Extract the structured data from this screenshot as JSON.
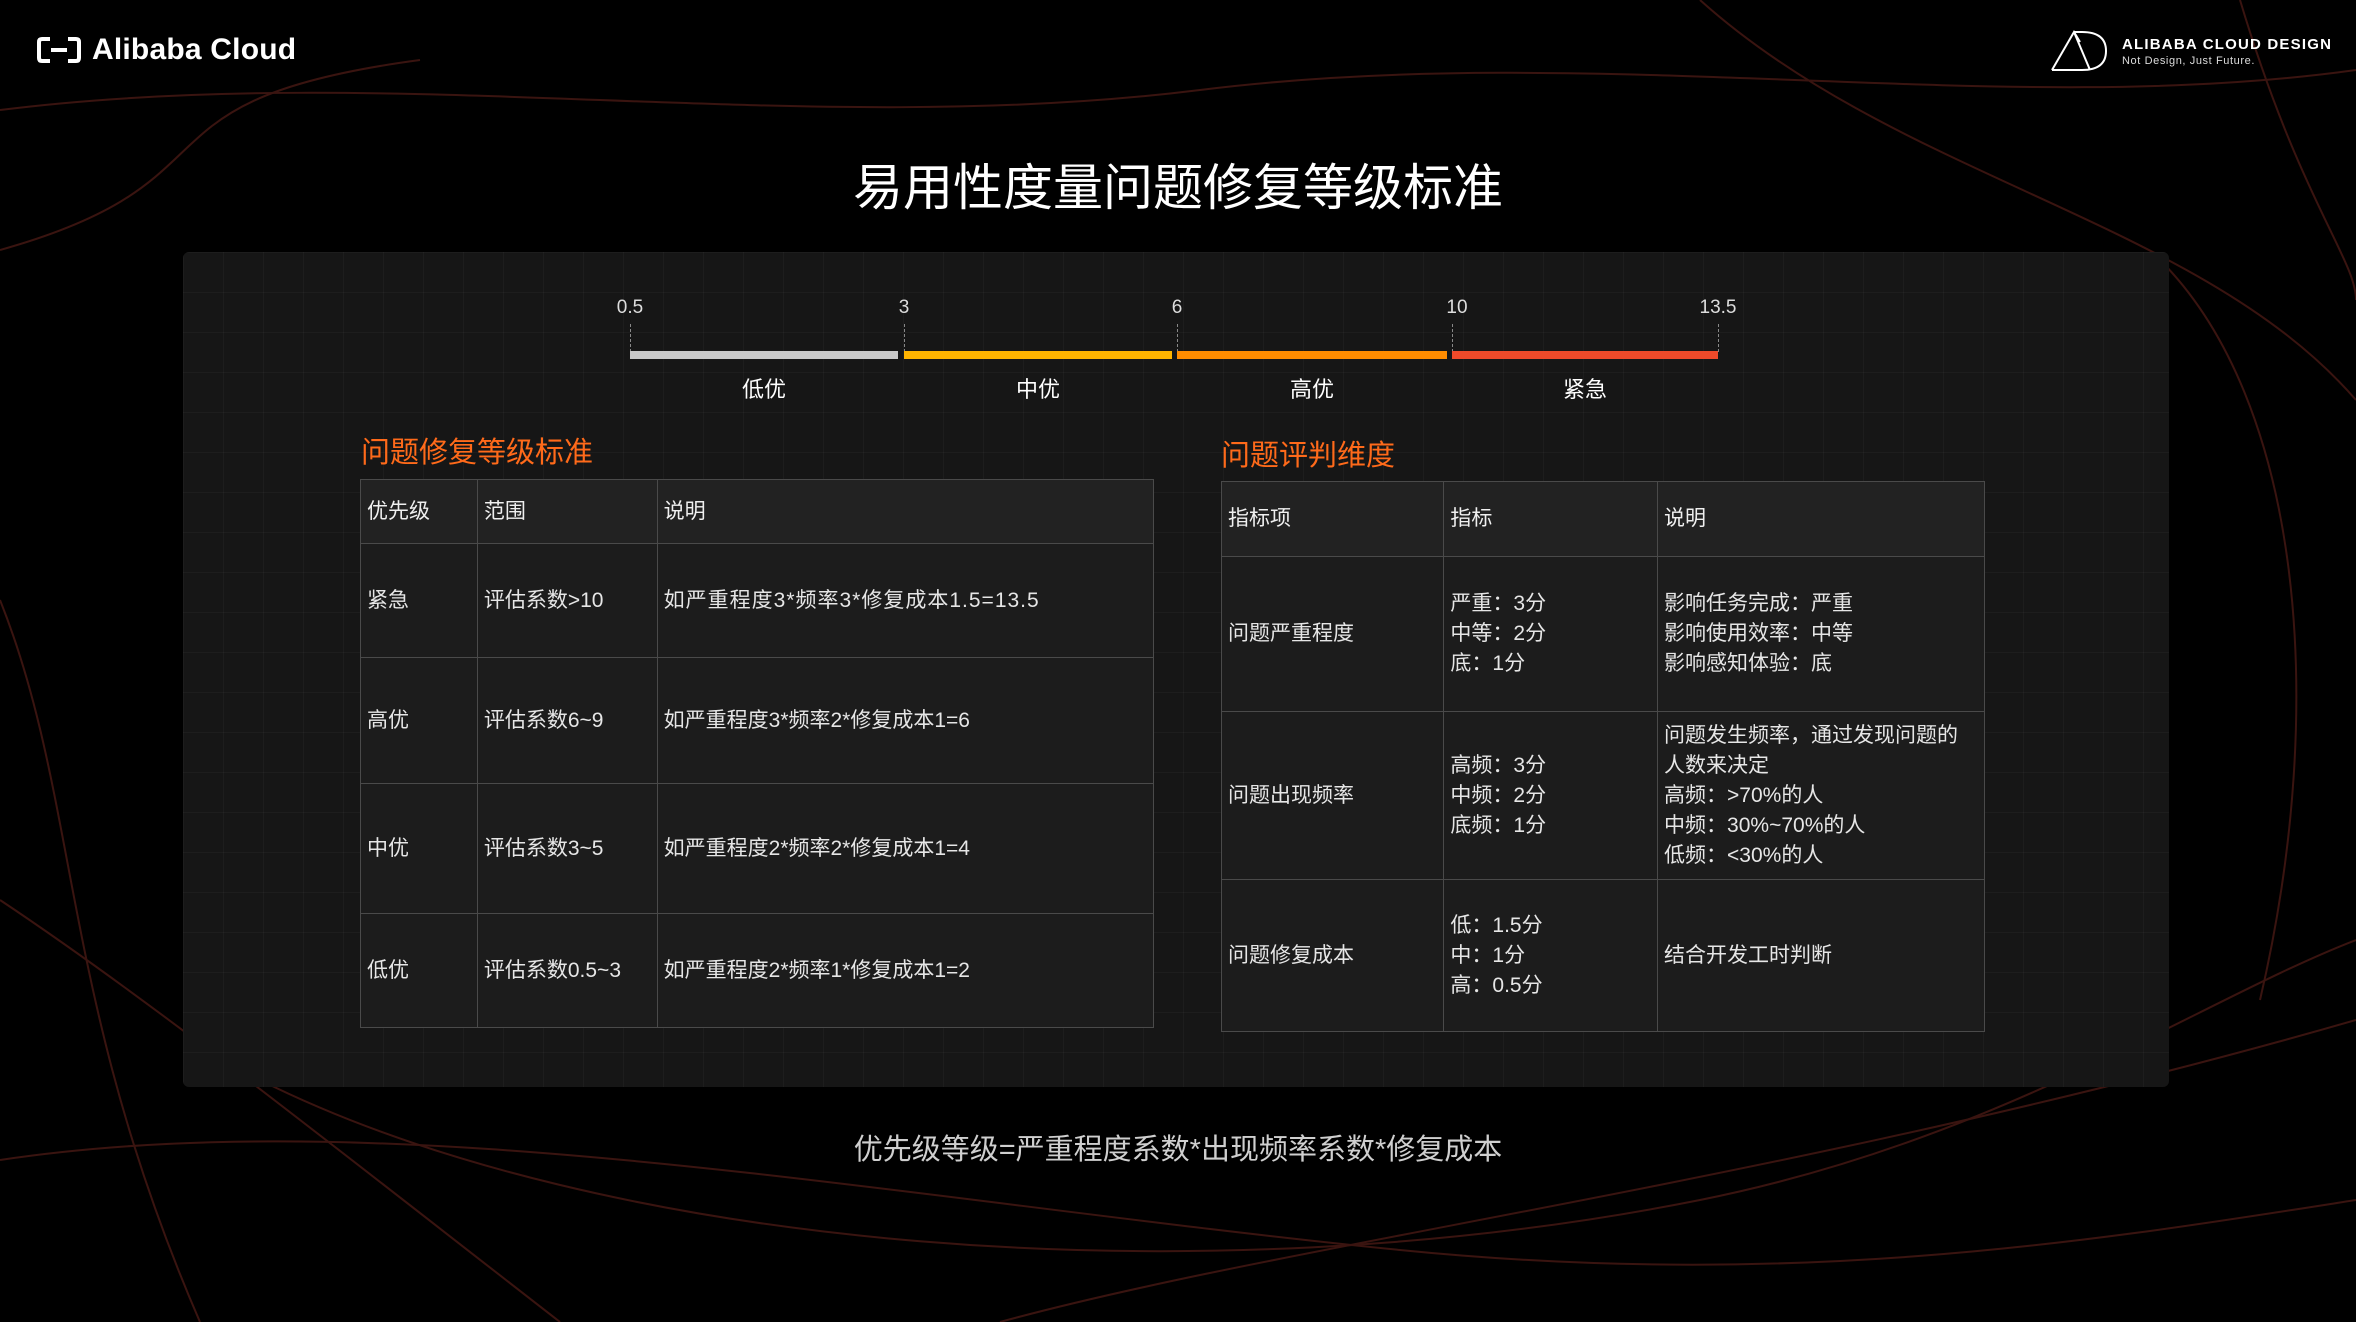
{
  "header": {
    "brand_left": "Alibaba Cloud",
    "brand_right": "ALIBABA CLOUD DESIGN",
    "brand_right_tagline": "Not Design, Just Future.",
    "logo_left_icon": "alibaba-cloud-bracket-icon",
    "logo_right_icon": "triangle-d-mark-icon"
  },
  "title": "易用性度量问题修复等级标准",
  "scale": {
    "ticks": [
      "0.5",
      "3",
      "6",
      "10",
      "13.5"
    ],
    "segments": [
      {
        "label": "低优",
        "color": "#c8c8c8"
      },
      {
        "label": "中优",
        "color": "#ffb400"
      },
      {
        "label": "高优",
        "color": "#ff8c00"
      },
      {
        "label": "紧急",
        "color": "#ee4a2a"
      }
    ]
  },
  "left_section": {
    "title": "问题修复等级标准",
    "headers": [
      "优先级",
      "范围",
      "说明"
    ],
    "rows": [
      [
        "紧急",
        "评估系数>10",
        "如严重程度3*频率3*修复成本1.5=13.5"
      ],
      [
        "高优",
        "评估系数6~9",
        "如严重程度3*频率2*修复成本1=6"
      ],
      [
        "中优",
        "评估系数3~5",
        "如严重程度2*频率2*修复成本1=4"
      ],
      [
        "低优",
        "评估系数0.5~3",
        "如严重程度2*频率1*修复成本1=2"
      ]
    ]
  },
  "right_section": {
    "title": "问题评判维度",
    "headers": [
      "指标项",
      "指标",
      "说明"
    ],
    "rows": [
      {
        "item": "问题严重程度",
        "metric": [
          "严重：3分",
          "中等：2分",
          "底：1分"
        ],
        "desc": [
          "影响任务完成：严重",
          "影响使用效率：中等",
          "影响感知体验：底"
        ]
      },
      {
        "item": "问题出现频率",
        "metric": [
          "高频：3分",
          "中频：2分",
          "底频：1分"
        ],
        "desc": [
          "问题发生频率，通过发现问题的",
          "人数来决定",
          "高频：>70%的人",
          "中频：30%~70%的人",
          "低频：<30%的人"
        ]
      },
      {
        "item": "问题修复成本",
        "metric": [
          "低：1.5分",
          "中：1分",
          "高：0.5分"
        ],
        "desc": [
          "结合开发工时判断"
        ]
      }
    ]
  },
  "formula": "优先级等级=严重程度系数*出现频率系数*修复成本",
  "colors": {
    "accent": "#ff6a1a",
    "background": "#000000",
    "panel": "#161616"
  }
}
